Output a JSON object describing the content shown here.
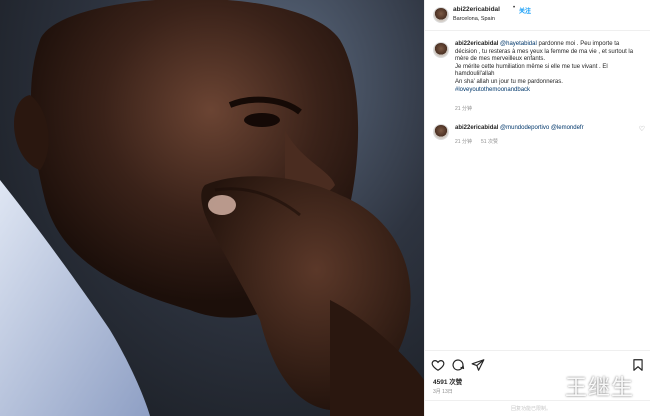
{
  "post": {
    "username": "abi22ericabidal",
    "location": "Barcelona, Spain",
    "follow_label": "关注"
  },
  "comments": [
    {
      "username": "abi22ericabidal",
      "lines": [
        {
          "mention": "@hayetabidal",
          "text": " pardonne moi . Peu importe ta"
        },
        {
          "text": "décision , tu resteras à mes yeux la femme de ma vie , et surtout la"
        },
        {
          "text": "mère de mes merveilleux enfants."
        },
        {
          "text": "Je mérite cette humiliation même si elle me tue vivant . El"
        },
        {
          "text": "hamdoulil'allah"
        },
        {
          "text": "An sha' allah un jour tu me pardonneras."
        },
        {
          "hashtag": "#loveyoutothemoonandback"
        }
      ],
      "time_ago": "21 分钟"
    },
    {
      "username": "abi22ericabidal",
      "mentions": [
        "@mundodeportivo",
        "@lemondefr"
      ],
      "time_ago": "21 分钟",
      "likes_label": "51 次赞"
    }
  ],
  "likes": "4591 次赞",
  "timestamp": "3月 13日",
  "footer_text": "回复功能已限制。",
  "watermark": "王继生",
  "icons": [
    "heart-icon",
    "comment-icon",
    "share-icon",
    "bookmark-icon"
  ],
  "colors": {
    "link": "#0095f6",
    "mention": "#00376b",
    "muted": "#8e8e8e"
  }
}
